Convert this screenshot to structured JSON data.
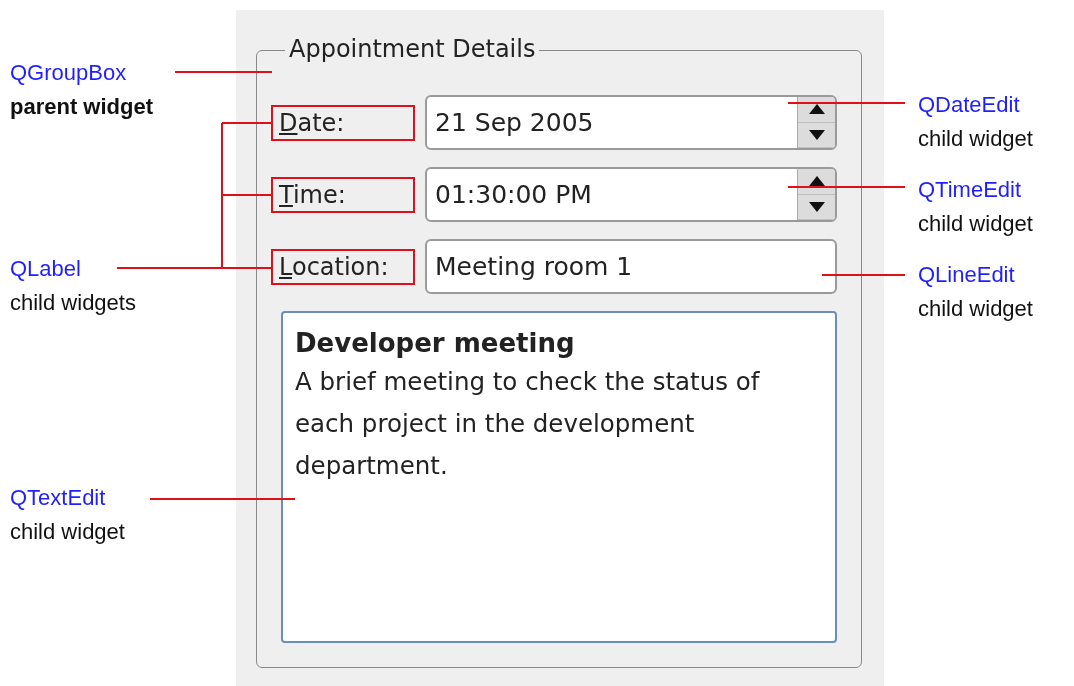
{
  "group_box": {
    "title": "Appointment Details",
    "rows": [
      {
        "kind": "spin",
        "label_key": "D",
        "label_rest": "ate:",
        "value": "21 Sep 2005"
      },
      {
        "kind": "spin",
        "label_key": "T",
        "label_rest": "ime:",
        "value": "01:30:00 PM"
      },
      {
        "kind": "line",
        "label_key": "L",
        "label_rest": "ocation:",
        "value": "Meeting room 1"
      }
    ],
    "text_edit": {
      "heading": "Developer meeting",
      "body": "A brief meeting to check the status of each project in the development department."
    }
  },
  "annotations": [
    {
      "class_name": "QGroupBox",
      "note": "parent widget",
      "emphasis": true
    },
    {
      "class_name": "QLabel",
      "note": "child widgets",
      "emphasis": false
    },
    {
      "class_name": "QTextEdit",
      "note": "child widget",
      "emphasis": false
    },
    {
      "class_name": "QDateEdit",
      "note": "child widget",
      "emphasis": false
    },
    {
      "class_name": "QTimeEdit",
      "note": "child widget",
      "emphasis": false
    },
    {
      "class_name": "QLineEdit",
      "note": "child widget",
      "emphasis": false
    }
  ]
}
